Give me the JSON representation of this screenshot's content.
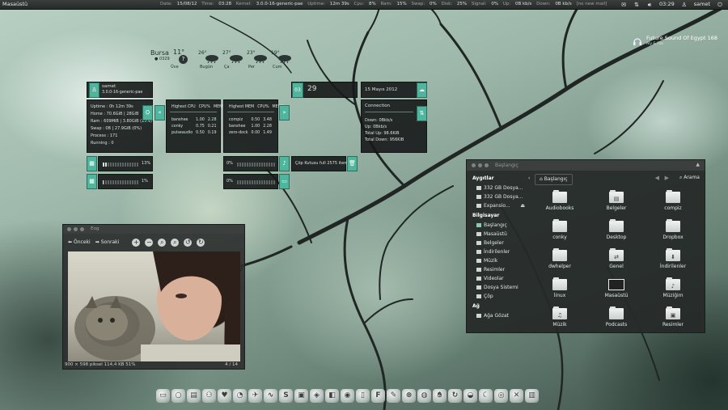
{
  "top_panel": {
    "menu_label": "Masaüstü",
    "stats": [
      {
        "label": "Date:",
        "value": "15/08/12"
      },
      {
        "label": "Time:",
        "value": "03:28"
      },
      {
        "label": "Kernel:",
        "value": "3.0.0-16-generic-pae"
      },
      {
        "label": "Uptime:",
        "value": "12m 39s"
      },
      {
        "label": "Cpu:",
        "value": "8%"
      },
      {
        "label": "Ram:",
        "value": "15%"
      },
      {
        "label": "Swap:",
        "value": "0%"
      },
      {
        "label": "Disk:",
        "value": "25%"
      },
      {
        "label": "Signal:",
        "value": "0%"
      },
      {
        "label": "Up:",
        "value": "0B kb/s"
      },
      {
        "label": "Down:",
        "value": "0B kb/s"
      }
    ],
    "new_mail": "[no new mail]",
    "clock": "03:29",
    "user": "samet"
  },
  "weather": {
    "city": "Bursa",
    "current_temp": "11°",
    "current_cond": "Üve",
    "small": "● 0329",
    "forecast": [
      {
        "temp": "26°",
        "day": "Bugün",
        "icon": "cloud-rain-icon"
      },
      {
        "temp": "27°",
        "day": "Ça",
        "icon": "cloud-rain-icon"
      },
      {
        "temp": "23°",
        "day": "Per",
        "icon": "cloud-rain-icon"
      },
      {
        "temp": "19°",
        "day": "Cum",
        "icon": "cloud-rain-icon"
      }
    ]
  },
  "music": {
    "song": "Future Sound Of Egypt 168",
    "sub": "Aly & Fila"
  },
  "conky": {
    "user": {
      "name": "samet",
      "kernel": "3.0.0-16-generic-pae"
    },
    "system": [
      "Uptime : 0h 12m 39s",
      "Home : 70.6GiB | 28GiB",
      "Ram : 609MiB | 3.80GiB (15%)",
      "Swap : 0B | 27.9GiB (0%)",
      "Process : 171",
      "Running : 0"
    ],
    "cpu_table": {
      "headers": [
        "Highest CPU",
        "CPU%",
        "MEM%"
      ],
      "rows": [
        [
          "banshee",
          "1.00",
          "2.28"
        ],
        [
          "conky",
          "0.75",
          "0.21"
        ],
        [
          "pulseaudio",
          "0.50",
          "0.19"
        ]
      ]
    },
    "mem_table": {
      "headers": [
        "Highest MEM",
        "CPU%",
        "MEM%"
      ],
      "rows": [
        [
          "compiz",
          "0.50",
          "3.48"
        ],
        [
          "banshee",
          "1.00",
          "2.28"
        ],
        [
          "zero-dock",
          "0.00",
          "1.49"
        ]
      ]
    },
    "day_num": "03",
    "day_big": "29",
    "date_line": "15 Mayıs 2012",
    "connection": {
      "title": "Connection",
      "lines": [
        "Down: 0Bkb/s",
        "Up: 0Bkb/s",
        "Total Up: 98.6KiB",
        "Total Down: 956KiB"
      ]
    },
    "cpu1": {
      "percent_label": "13%",
      "fill": 0.13
    },
    "cpu2": {
      "percent_label": "1%",
      "fill": 0.01
    },
    "vol": {
      "percent_label": "0%",
      "fill": 0.0
    },
    "bat": {
      "percent_label": "0%",
      "fill": 0.0
    },
    "trash": {
      "label": "Çöp Kutusu full",
      "count": "2575",
      "items": "items"
    }
  },
  "viewer": {
    "title": "Eog",
    "back_label": "Önceki",
    "next_label": "Sonraki",
    "status_left": "900 × 598 piksel   114,4 KB    51%",
    "status_right": "4 / 14"
  },
  "file_manager": {
    "title": "Başlangıç",
    "sections": [
      {
        "title": "Aygıtlar",
        "items": [
          "332 GB Dosya...",
          "332 GB Dosya...",
          "Expansio..."
        ]
      },
      {
        "title": "Bilgisayar",
        "items": [
          "Başlangıç",
          "Masaüstü",
          "Belgeler",
          "İndirilenler",
          "Müzik",
          "Resimler",
          "Videolar",
          "Dosya Sistemi",
          "Çöp"
        ]
      },
      {
        "title": "Ağ",
        "items": [
          "Ağa Gözat"
        ]
      }
    ],
    "crumb": "Başlangıç",
    "search_label": "Arama",
    "files": [
      "Audiobooks",
      "Belgeler",
      "compiz",
      "conky",
      "Desktop",
      "Dropbox",
      "dwhelper",
      "Genel",
      "İndirilenler",
      "linux",
      "Masaüstü",
      "Müziğim",
      "Müzik",
      "Podcasts",
      "Resimler"
    ]
  },
  "dock": {
    "icons": [
      "monitor-icon",
      "circle-icon",
      "terminal-icon",
      "users-icon",
      "heart-icon",
      "chat-icon",
      "bird-icon",
      "pulse-icon",
      "skype-icon",
      "screenshot-icon",
      "cube-icon",
      "window-icon",
      "eye-icon",
      "document-icon",
      "font-icon",
      "pen-icon",
      "lifebuoy-icon",
      "globe-icon",
      "hand-icon",
      "circle-arrow-icon",
      "drop-icon",
      "moon-icon",
      "dial-icon",
      "close-x-icon",
      "trash-icon"
    ]
  }
}
